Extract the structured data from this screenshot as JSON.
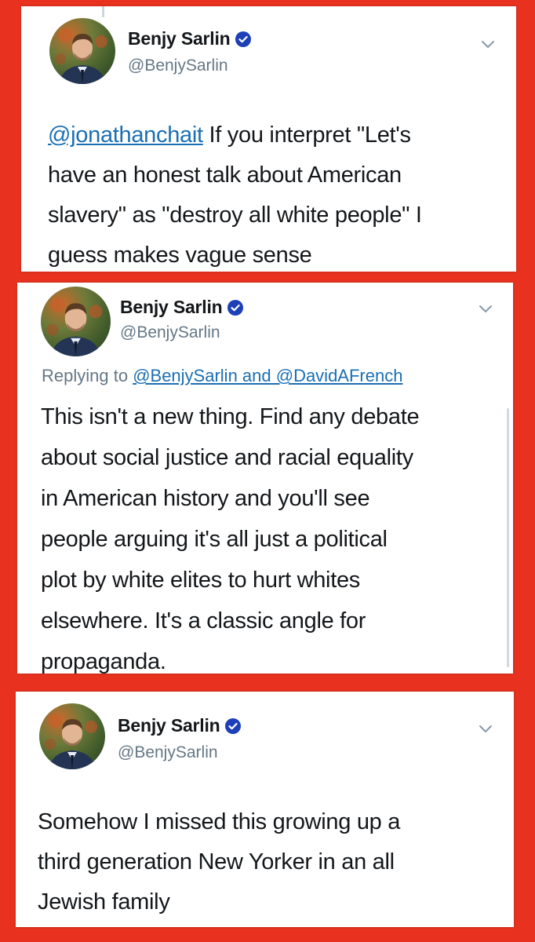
{
  "tweets": [
    {
      "display_name": "Benjy Sarlin",
      "handle": "@BenjySarlin",
      "mention": "@jonathanchait",
      "text_line_1": " If you interpret \"Let's",
      "text_line_2": "have an honest talk about American",
      "text_line_3": "slavery\" as \"destroy all white people\" I",
      "text_line_4": "guess makes vague sense"
    },
    {
      "display_name": "Benjy Sarlin",
      "handle": "@BenjySarlin",
      "replying_prefix": "Replying to ",
      "replying_to": "@BenjySarlin and @DavidAFrench",
      "text_line_1": "This isn't a new thing. Find any debate",
      "text_line_2": "about social justice and racial equality",
      "text_line_3": "in American history and you'll see",
      "text_line_4": "people arguing it's all just a political",
      "text_line_5": "plot by white elites to hurt whites",
      "text_line_6": "elsewhere. It's a classic angle for",
      "text_line_7": "propaganda."
    },
    {
      "display_name": "Benjy Sarlin",
      "handle": "@BenjySarlin",
      "text_line_1": "Somehow I missed this growing up a",
      "text_line_2": "third generation New Yorker in an all",
      "text_line_3": "Jewish family"
    }
  ],
  "icons": {
    "verified": "verified-badge-icon",
    "menu": "chevron-down-icon",
    "avatar": "profile-photo"
  },
  "colors": {
    "background": "#e8321f",
    "card": "#ffffff",
    "text": "#14171a",
    "secondary_text": "#657786",
    "link": "#1b6fb3",
    "verified": "#1d3fb8"
  }
}
